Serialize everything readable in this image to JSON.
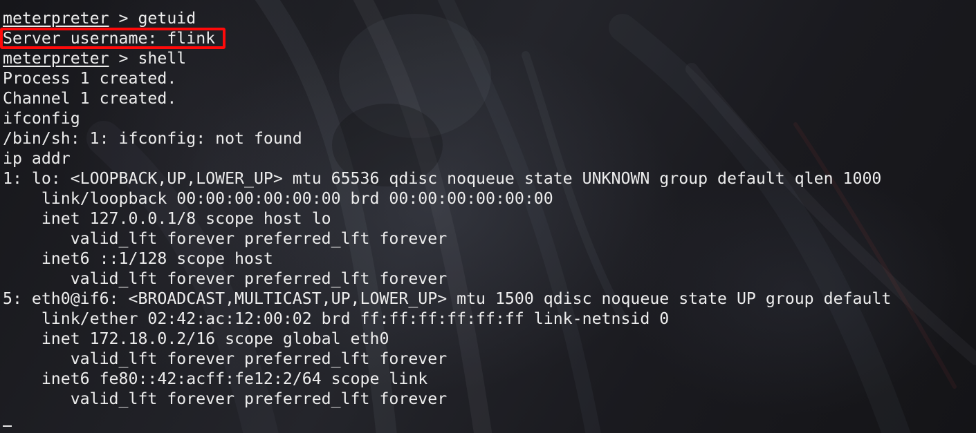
{
  "terminal": {
    "lines": [
      {
        "prompt": "meterpreter",
        "rest": " > getuid"
      },
      {
        "text": "Server username: flink",
        "highlighted": true
      },
      {
        "prompt": "meterpreter",
        "rest": " > shell"
      },
      {
        "text": "Process 1 created."
      },
      {
        "text": "Channel 1 created."
      },
      {
        "text": "ifconfig"
      },
      {
        "text": "/bin/sh: 1: ifconfig: not found"
      },
      {
        "text": "ip addr"
      },
      {
        "text": "1: lo: <LOOPBACK,UP,LOWER_UP> mtu 65536 qdisc noqueue state UNKNOWN group default qlen 1000"
      },
      {
        "text": "    link/loopback 00:00:00:00:00:00 brd 00:00:00:00:00:00"
      },
      {
        "text": "    inet 127.0.0.1/8 scope host lo"
      },
      {
        "text": "       valid_lft forever preferred_lft forever"
      },
      {
        "text": "    inet6 ::1/128 scope host"
      },
      {
        "text": "       valid_lft forever preferred_lft forever"
      },
      {
        "text": "5: eth0@if6: <BROADCAST,MULTICAST,UP,LOWER_UP> mtu 1500 qdisc noqueue state UP group default"
      },
      {
        "text": "    link/ether 02:42:ac:12:00:02 brd ff:ff:ff:ff:ff:ff link-netnsid 0"
      },
      {
        "text": "    inet 172.18.0.2/16 scope global eth0"
      },
      {
        "text": "       valid_lft forever preferred_lft forever"
      },
      {
        "text": "    inet6 fe80::42:acff:fe12:2/64 scope link"
      },
      {
        "text": "       valid_lft forever preferred_lft forever"
      },
      {
        "text": ""
      }
    ]
  },
  "colors": {
    "text": "#ededed",
    "highlight_border": "#ff0a0a",
    "background": "#1c1c1e"
  }
}
